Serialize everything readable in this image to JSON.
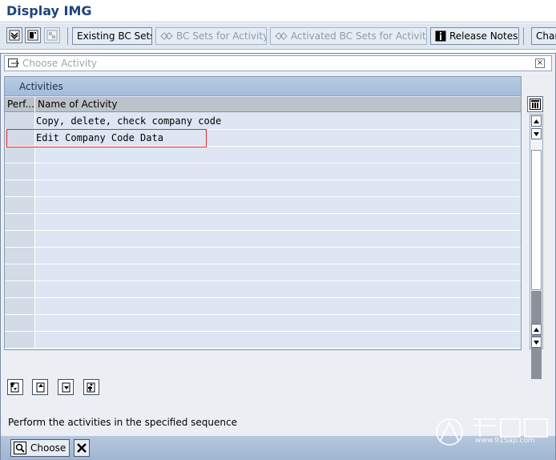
{
  "app": {
    "title": "Display IMG"
  },
  "toolbar": {
    "icons": [
      "expand-all-icon",
      "where-used-icon",
      "hierarchy-icon"
    ],
    "buttons": [
      {
        "label": "Existing BC Sets",
        "enabled": true
      },
      {
        "label": "BC Sets for Activity",
        "enabled": false,
        "icon": "bc-set-icon"
      },
      {
        "label": "Activated BC Sets for Activity",
        "enabled": false,
        "icon": "bc-set-icon"
      },
      {
        "label": "Release Notes",
        "enabled": true,
        "icon": "info-icon"
      },
      {
        "label": "Char",
        "enabled": true
      }
    ]
  },
  "dialog": {
    "title": "Choose Activity",
    "table": {
      "caption": "Activities",
      "columns": [
        "Perf...",
        "Name of Activity"
      ],
      "rows": [
        {
          "perf": "",
          "name": "Copy, delete, check company code"
        },
        {
          "perf": "",
          "name": "Edit Company Code Data"
        },
        {
          "perf": "",
          "name": ""
        },
        {
          "perf": "",
          "name": ""
        },
        {
          "perf": "",
          "name": ""
        },
        {
          "perf": "",
          "name": ""
        },
        {
          "perf": "",
          "name": ""
        },
        {
          "perf": "",
          "name": ""
        },
        {
          "perf": "",
          "name": ""
        },
        {
          "perf": "",
          "name": ""
        },
        {
          "perf": "",
          "name": ""
        },
        {
          "perf": "",
          "name": ""
        },
        {
          "perf": "",
          "name": ""
        },
        {
          "perf": "",
          "name": ""
        }
      ],
      "highlighted_row": "Edit Company Code Data"
    },
    "sequence_buttons": [
      "first-page-icon",
      "previous-page-icon",
      "next-page-icon",
      "last-page-icon"
    ],
    "hint": "Perform the activities in the specified sequence",
    "choose_label": "Choose"
  },
  "colors": {
    "title": "#20457a",
    "highlight": "#e32b2b",
    "table_bg": "#dde6f2"
  },
  "watermark": {
    "url": "www.91Sap.com"
  }
}
